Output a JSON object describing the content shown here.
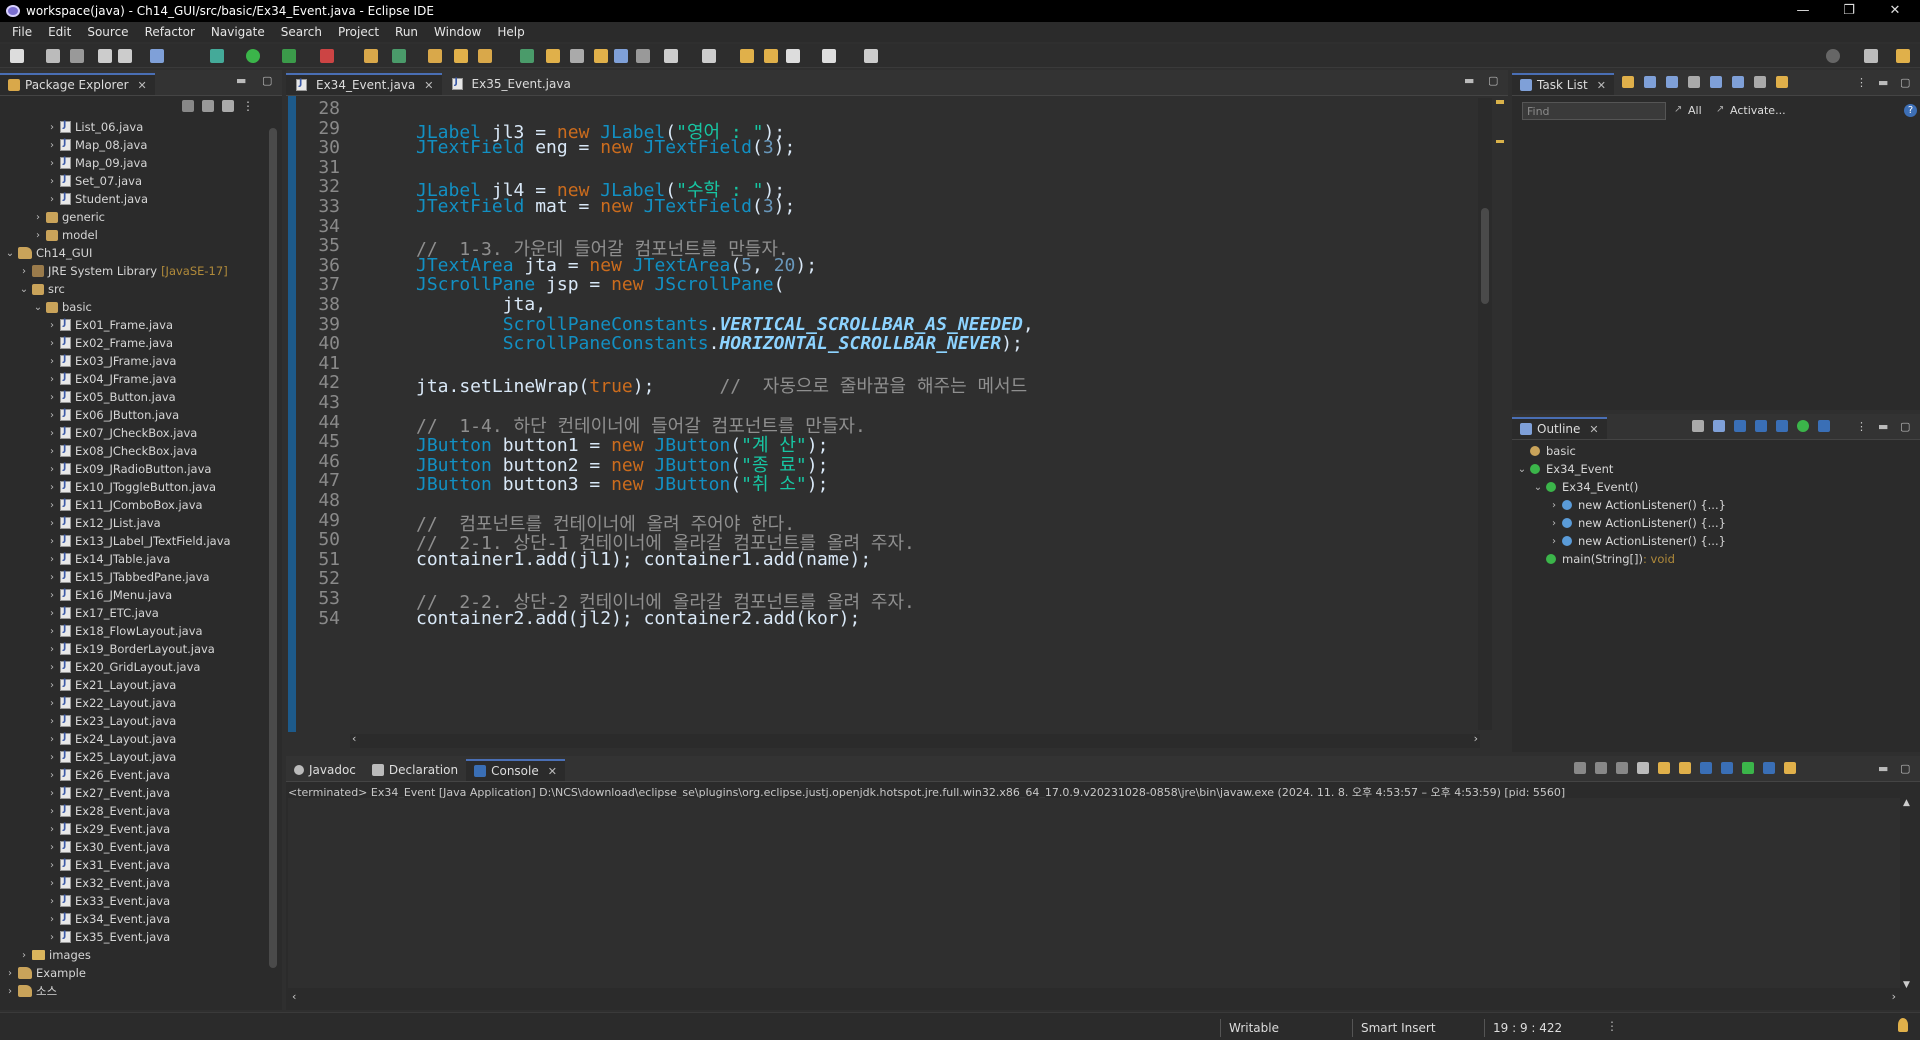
{
  "window": {
    "title": "workspace(java) - Ch14_GUI/src/basic/Ex34_Event.java - Eclipse IDE",
    "min": "—",
    "max": "❐",
    "close": "✕"
  },
  "menu": [
    "File",
    "Edit",
    "Source",
    "Refactor",
    "Navigate",
    "Search",
    "Project",
    "Run",
    "Window",
    "Help"
  ],
  "package_explorer": {
    "title": "Package Explorer",
    "rows": [
      {
        "label": "List_06.java",
        "kind": "java",
        "indent": 3,
        "arrow": ">"
      },
      {
        "label": "Map_08.java",
        "kind": "java",
        "indent": 3,
        "arrow": ">"
      },
      {
        "label": "Map_09.java",
        "kind": "java",
        "indent": 3,
        "arrow": ">"
      },
      {
        "label": "Set_07.java",
        "kind": "java",
        "indent": 3,
        "arrow": ">"
      },
      {
        "label": "Student.java",
        "kind": "java",
        "indent": 3,
        "arrow": ">"
      },
      {
        "label": "generic",
        "kind": "pkg",
        "indent": 2,
        "arrow": ">"
      },
      {
        "label": "model",
        "kind": "pkg",
        "indent": 2,
        "arrow": ">"
      },
      {
        "label": "Ch14_GUI",
        "kind": "proj",
        "indent": 0,
        "arrow": "v"
      },
      {
        "label": "JRE System Library",
        "extra": "[JavaSE-17]",
        "kind": "lib",
        "indent": 1,
        "arrow": ">"
      },
      {
        "label": "src",
        "kind": "pkg",
        "indent": 1,
        "arrow": "v"
      },
      {
        "label": "basic",
        "kind": "pkg",
        "indent": 2,
        "arrow": "v"
      },
      {
        "label": "Ex01_Frame.java",
        "kind": "java",
        "indent": 3,
        "arrow": ">"
      },
      {
        "label": "Ex02_Frame.java",
        "kind": "java",
        "indent": 3,
        "arrow": ">"
      },
      {
        "label": "Ex03_JFrame.java",
        "kind": "java",
        "indent": 3,
        "arrow": ">"
      },
      {
        "label": "Ex04_JFrame.java",
        "kind": "java",
        "indent": 3,
        "arrow": ">"
      },
      {
        "label": "Ex05_Button.java",
        "kind": "java",
        "indent": 3,
        "arrow": ">"
      },
      {
        "label": "Ex06_JButton.java",
        "kind": "java",
        "indent": 3,
        "arrow": ">"
      },
      {
        "label": "Ex07_JCheckBox.java",
        "kind": "java",
        "indent": 3,
        "arrow": ">"
      },
      {
        "label": "Ex08_JCheckBox.java",
        "kind": "java",
        "indent": 3,
        "arrow": ">"
      },
      {
        "label": "Ex09_JRadioButton.java",
        "kind": "java",
        "indent": 3,
        "arrow": ">"
      },
      {
        "label": "Ex10_JToggleButton.java",
        "kind": "java",
        "indent": 3,
        "arrow": ">"
      },
      {
        "label": "Ex11_JComboBox.java",
        "kind": "java",
        "indent": 3,
        "arrow": ">"
      },
      {
        "label": "Ex12_JList.java",
        "kind": "java",
        "indent": 3,
        "arrow": ">"
      },
      {
        "label": "Ex13_JLabel_JTextField.java",
        "kind": "java",
        "indent": 3,
        "arrow": ">"
      },
      {
        "label": "Ex14_JTable.java",
        "kind": "java",
        "indent": 3,
        "arrow": ">"
      },
      {
        "label": "Ex15_JTabbedPane.java",
        "kind": "java",
        "indent": 3,
        "arrow": ">"
      },
      {
        "label": "Ex16_JMenu.java",
        "kind": "java",
        "indent": 3,
        "arrow": ">"
      },
      {
        "label": "Ex17_ETC.java",
        "kind": "java",
        "indent": 3,
        "arrow": ">"
      },
      {
        "label": "Ex18_FlowLayout.java",
        "kind": "java",
        "indent": 3,
        "arrow": ">"
      },
      {
        "label": "Ex19_BorderLayout.java",
        "kind": "java",
        "indent": 3,
        "arrow": ">"
      },
      {
        "label": "Ex20_GridLayout.java",
        "kind": "java",
        "indent": 3,
        "arrow": ">"
      },
      {
        "label": "Ex21_Layout.java",
        "kind": "java",
        "indent": 3,
        "arrow": ">"
      },
      {
        "label": "Ex22_Layout.java",
        "kind": "java",
        "indent": 3,
        "arrow": ">"
      },
      {
        "label": "Ex23_Layout.java",
        "kind": "java",
        "indent": 3,
        "arrow": ">"
      },
      {
        "label": "Ex24_Layout.java",
        "kind": "java",
        "indent": 3,
        "arrow": ">"
      },
      {
        "label": "Ex25_Layout.java",
        "kind": "java",
        "indent": 3,
        "arrow": ">"
      },
      {
        "label": "Ex26_Event.java",
        "kind": "java",
        "indent": 3,
        "arrow": ">"
      },
      {
        "label": "Ex27_Event.java",
        "kind": "java",
        "indent": 3,
        "arrow": ">"
      },
      {
        "label": "Ex28_Event.java",
        "kind": "java",
        "indent": 3,
        "arrow": ">"
      },
      {
        "label": "Ex29_Event.java",
        "kind": "java",
        "indent": 3,
        "arrow": ">"
      },
      {
        "label": "Ex30_Event.java",
        "kind": "java",
        "indent": 3,
        "arrow": ">"
      },
      {
        "label": "Ex31_Event.java",
        "kind": "java",
        "indent": 3,
        "arrow": ">"
      },
      {
        "label": "Ex32_Event.java",
        "kind": "java",
        "indent": 3,
        "arrow": ">"
      },
      {
        "label": "Ex33_Event.java",
        "kind": "java",
        "indent": 3,
        "arrow": ">"
      },
      {
        "label": "Ex34_Event.java",
        "kind": "java",
        "indent": 3,
        "arrow": ">"
      },
      {
        "label": "Ex35_Event.java",
        "kind": "java",
        "indent": 3,
        "arrow": ">"
      },
      {
        "label": "images",
        "kind": "folder",
        "indent": 1,
        "arrow": ">"
      },
      {
        "label": "Example",
        "kind": "proj",
        "indent": 0,
        "arrow": ">"
      },
      {
        "label": "소스",
        "kind": "proj",
        "indent": 0,
        "arrow": ">"
      }
    ]
  },
  "editor": {
    "tabs": [
      {
        "label": "Ex34_Event.java",
        "active": true
      },
      {
        "label": "Ex35_Event.java",
        "active": false
      }
    ],
    "lines": [
      {
        "n": "28",
        "tokens": []
      },
      {
        "n": "29",
        "tokens": [
          [
            "t",
            "JLabel"
          ],
          [
            "m",
            " jl3 = "
          ],
          [
            "k",
            "new"
          ],
          [
            "m",
            " "
          ],
          [
            "t",
            "JLabel"
          ],
          [
            "m",
            "("
          ],
          [
            "s",
            "\"영어 : \""
          ],
          [
            "m",
            ");"
          ]
        ]
      },
      {
        "n": "30",
        "tokens": [
          [
            "t",
            "JTextField"
          ],
          [
            "m",
            " eng = "
          ],
          [
            "k",
            "new"
          ],
          [
            "m",
            " "
          ],
          [
            "t",
            "JTextField"
          ],
          [
            "m",
            "("
          ],
          [
            "n",
            "3"
          ],
          [
            "m",
            ");"
          ]
        ]
      },
      {
        "n": "31",
        "tokens": []
      },
      {
        "n": "32",
        "tokens": [
          [
            "t",
            "JLabel"
          ],
          [
            "m",
            " jl4 = "
          ],
          [
            "k",
            "new"
          ],
          [
            "m",
            " "
          ],
          [
            "t",
            "JLabel"
          ],
          [
            "m",
            "("
          ],
          [
            "s",
            "\"수학 : \""
          ],
          [
            "m",
            ");"
          ]
        ]
      },
      {
        "n": "33",
        "tokens": [
          [
            "t",
            "JTextField"
          ],
          [
            "m",
            " mat = "
          ],
          [
            "k",
            "new"
          ],
          [
            "m",
            " "
          ],
          [
            "t",
            "JTextField"
          ],
          [
            "m",
            "("
          ],
          [
            "n",
            "3"
          ],
          [
            "m",
            ");"
          ]
        ]
      },
      {
        "n": "34",
        "tokens": []
      },
      {
        "n": "35",
        "tokens": [
          [
            "c",
            "//  1-3. 가운데 들어갈 컴포넌트를 만들자."
          ]
        ]
      },
      {
        "n": "36",
        "tokens": [
          [
            "t",
            "JTextArea"
          ],
          [
            "m",
            " jta = "
          ],
          [
            "k",
            "new"
          ],
          [
            "m",
            " "
          ],
          [
            "t",
            "JTextArea"
          ],
          [
            "m",
            "("
          ],
          [
            "n",
            "5"
          ],
          [
            "m",
            ", "
          ],
          [
            "n",
            "20"
          ],
          [
            "m",
            ");"
          ]
        ]
      },
      {
        "n": "37",
        "tokens": [
          [
            "t",
            "JScrollPane"
          ],
          [
            "m",
            " jsp = "
          ],
          [
            "k",
            "new"
          ],
          [
            "m",
            " "
          ],
          [
            "t",
            "JScrollPane"
          ],
          [
            "m",
            "("
          ]
        ]
      },
      {
        "n": "38",
        "tokens": [
          [
            "m",
            "        jta,"
          ]
        ]
      },
      {
        "n": "39",
        "tokens": [
          [
            "m",
            "        "
          ],
          [
            "t",
            "ScrollPaneConstants"
          ],
          [
            "m",
            "."
          ],
          [
            "f",
            "VERTICAL_SCROLLBAR_AS_NEEDED"
          ],
          [
            "m",
            ","
          ]
        ]
      },
      {
        "n": "40",
        "tokens": [
          [
            "m",
            "        "
          ],
          [
            "t",
            "ScrollPaneConstants"
          ],
          [
            "m",
            "."
          ],
          [
            "f",
            "HORIZONTAL_SCROLLBAR_NEVER"
          ],
          [
            "m",
            ");"
          ]
        ]
      },
      {
        "n": "41",
        "tokens": []
      },
      {
        "n": "42",
        "tokens": [
          [
            "m",
            "jta.setLineWrap("
          ],
          [
            "k",
            "true"
          ],
          [
            "m",
            ");      "
          ],
          [
            "c",
            "//  자동으로 줄바꿈을 해주는 메서드"
          ]
        ]
      },
      {
        "n": "43",
        "tokens": []
      },
      {
        "n": "44",
        "tokens": [
          [
            "c",
            "//  1-4. 하단 컨테이너에 들어갈 컴포넌트를 만들자."
          ]
        ]
      },
      {
        "n": "45",
        "tokens": [
          [
            "t",
            "JButton"
          ],
          [
            "m",
            " button1 = "
          ],
          [
            "k",
            "new"
          ],
          [
            "m",
            " "
          ],
          [
            "t",
            "JButton"
          ],
          [
            "m",
            "("
          ],
          [
            "s",
            "\"계 산\""
          ],
          [
            "m",
            ");"
          ]
        ]
      },
      {
        "n": "46",
        "tokens": [
          [
            "t",
            "JButton"
          ],
          [
            "m",
            " button2 = "
          ],
          [
            "k",
            "new"
          ],
          [
            "m",
            " "
          ],
          [
            "t",
            "JButton"
          ],
          [
            "m",
            "("
          ],
          [
            "s",
            "\"종 료\""
          ],
          [
            "m",
            ");"
          ]
        ]
      },
      {
        "n": "47",
        "tokens": [
          [
            "t",
            "JButton"
          ],
          [
            "m",
            " button3 = "
          ],
          [
            "k",
            "new"
          ],
          [
            "m",
            " "
          ],
          [
            "t",
            "JButton"
          ],
          [
            "m",
            "("
          ],
          [
            "s",
            "\"취 소\""
          ],
          [
            "m",
            ");"
          ]
        ]
      },
      {
        "n": "48",
        "tokens": []
      },
      {
        "n": "49",
        "tokens": [
          [
            "c",
            "//  컴포넌트를 컨테이너에 올려 주어야 한다."
          ]
        ]
      },
      {
        "n": "50",
        "tokens": [
          [
            "c",
            "//  2-1. 상단-1 컨테이너에 올라갈 컴포넌트를 올려 주자."
          ]
        ]
      },
      {
        "n": "51",
        "tokens": [
          [
            "m",
            "container1.add(jl1); container1.add(name);"
          ]
        ]
      },
      {
        "n": "52",
        "tokens": []
      },
      {
        "n": "53",
        "tokens": [
          [
            "c",
            "//  2-2. 상단-2 컨테이너에 올라갈 컴포넌트를 올려 주자."
          ]
        ]
      },
      {
        "n": "54",
        "tokens": [
          [
            "m",
            "container2.add(jl2); container2.add(kor);"
          ]
        ]
      }
    ]
  },
  "task_list": {
    "title": "Task List",
    "find_placeholder": "Find",
    "all": "All",
    "activate": "Activate..."
  },
  "outline": {
    "title": "Outline",
    "rows": [
      {
        "label": "basic",
        "indent": 0,
        "arrow": ""
      },
      {
        "label": "Ex34_Event",
        "indent": 0,
        "arrow": "v"
      },
      {
        "label": "Ex34_Event()",
        "indent": 1,
        "arrow": "v"
      },
      {
        "label": "new ActionListener() {...}",
        "indent": 2,
        "arrow": ">"
      },
      {
        "label": "new ActionListener() {...}",
        "indent": 2,
        "arrow": ">"
      },
      {
        "label": "new ActionListener() {...}",
        "indent": 2,
        "arrow": ">"
      },
      {
        "label": "main(String[])",
        "extra": " : void",
        "indent": 1,
        "arrow": ""
      }
    ]
  },
  "bottom": {
    "tabs": [
      {
        "label": "Javadoc",
        "active": false
      },
      {
        "label": "Declaration",
        "active": false
      },
      {
        "label": "Console",
        "active": true
      }
    ],
    "console_line": "<terminated> Ex34_Event [Java Application] D:\\NCS\\download\\eclipse_se\\plugins\\org.eclipse.justj.openjdk.hotspot.jre.full.win32.x86_64_17.0.9.v20231028-0858\\jre\\bin\\javaw.exe  (2024. 11. 8. 오후 4:53:57 – 오후 4:53:59) [pid: 5560]"
  },
  "status": {
    "writable": "Writable",
    "insert_mode": "Smart Insert",
    "position": "19 : 9 : 422"
  },
  "colors": {
    "type": "#1290c3",
    "keyword": "#cc6c1d",
    "string": "#17c6a3",
    "comment": "#8f8f8f",
    "number": "#6897bb"
  }
}
